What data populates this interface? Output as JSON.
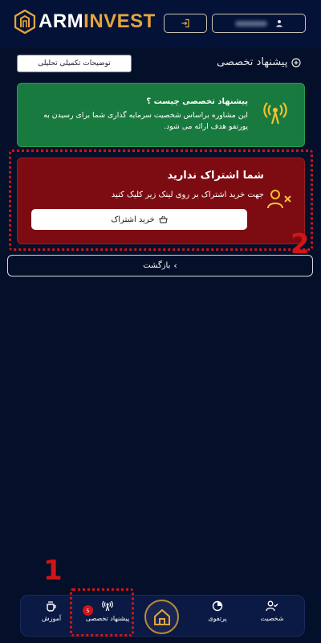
{
  "header": {
    "brand_primary": "ARM",
    "brand_secondary": "INVEST",
    "login_icon": "login-icon",
    "user_icon": "user-icon"
  },
  "section": {
    "title": "پیشنهاد تخصصی",
    "details_button": "توضیحات تکمیلی تحلیلی"
  },
  "info_card": {
    "title": "پیشنهاد تخصصی چیست ؟",
    "text": "این مشاوره براساس شخصیت سرمایه گذاری شما برای رسیدن به پورتفو هدف ارائه می شود.",
    "icon": "broadcast-icon"
  },
  "subscription_card": {
    "title": "شما اشتراک ندارید",
    "text": "جهت خرید اشتراک بر روی لینک زیر کلیک کنید",
    "button": "خرید اشتراک",
    "icon": "user-x-icon"
  },
  "back_button": "بازگشت",
  "annotations": {
    "marker_1": "1",
    "marker_2": "2"
  },
  "nav": {
    "education": "آموزش",
    "advice": "پیشنهاد تخصصی",
    "advice_badge": "5",
    "portfolio": "پرتفوی",
    "personality": "شخصیت"
  },
  "colors": {
    "background": "#04102a",
    "header": "#041237",
    "accent_gold": "#e4a63a",
    "info_green": "#187a3e",
    "alert_red": "#7d0b12",
    "annotation_red": "#d11418"
  }
}
